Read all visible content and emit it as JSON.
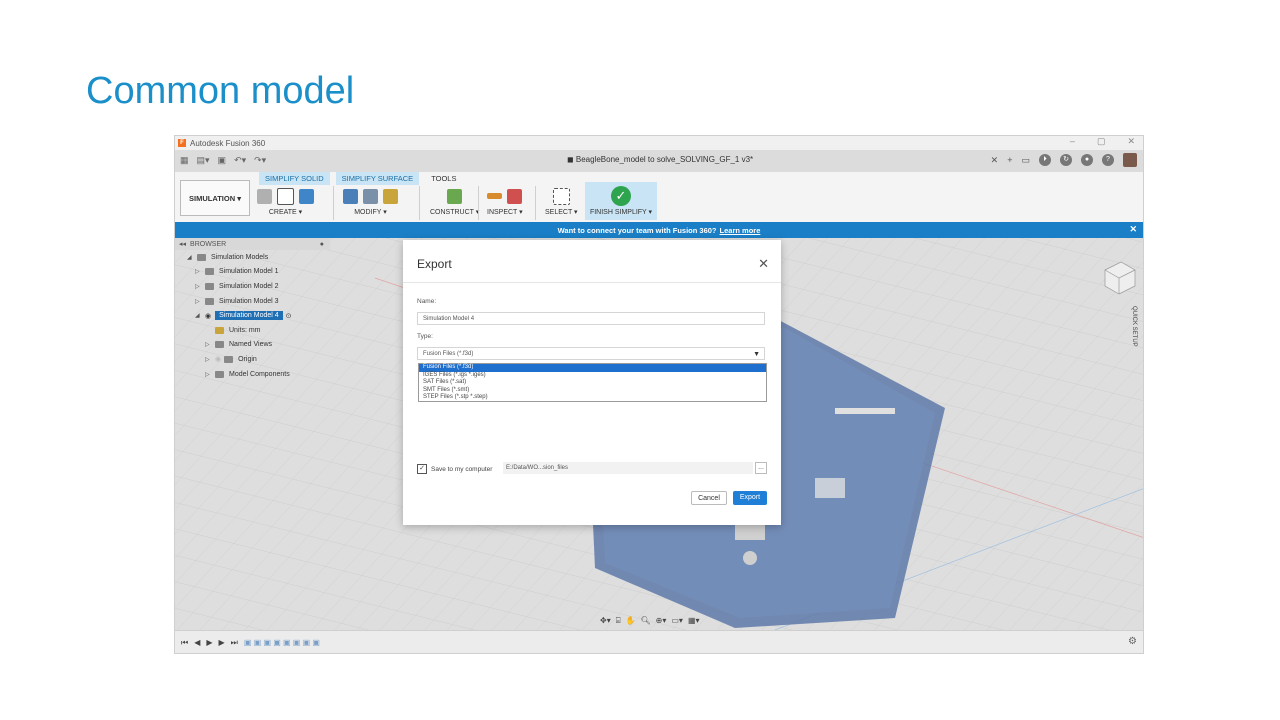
{
  "slide": {
    "title": "Common model"
  },
  "app": {
    "window_title": "Autodesk Fusion 360",
    "document_tab": "BeagleBone_model to solve_SOLVING_GF_1 v3*",
    "workspace": "SIMULATION ▾",
    "tabs": [
      "SIMPLIFY SOLID",
      "SIMPLIFY SURFACE",
      "TOOLS"
    ],
    "groups": {
      "create": "CREATE ▾",
      "modify": "MODIFY ▾",
      "construct": "CONSTRUCT ▾",
      "inspect": "INSPECT ▾",
      "select": "SELECT ▾",
      "finish": "FINISH SIMPLIFY ▾"
    },
    "banner": {
      "text": "Want to connect your team with Fusion 360?",
      "link": "Learn more"
    },
    "browser": {
      "header": "BROWSER",
      "items": {
        "root": "Simulation Models",
        "m1": "Simulation Model 1",
        "m2": "Simulation Model 2",
        "m3": "Simulation Model 3",
        "m4": "Simulation Model 4",
        "units": "Units: mm",
        "named_views": "Named Views",
        "origin": "Origin",
        "model_components": "Model Components"
      }
    },
    "quick_setup": "QUICK SETUP",
    "colors": {
      "accent": "#1a7fc6",
      "finish_check": "#2ea44f",
      "selection": "#1f6fce"
    }
  },
  "dialog": {
    "title": "Export",
    "name_label": "Name:",
    "name_value": "Simulation Model 4",
    "type_label": "Type:",
    "type_value": "Fusion Files (*.f3d)",
    "type_options": [
      "Fusion Files (*.f3d)",
      "IGES Files (*.igs *.iges)",
      "SAT Files (*.sat)",
      "SMT Files (*.smt)",
      "STEP Files (*.stp *.step)"
    ],
    "save_label": "Save to my computer",
    "save_checked": true,
    "path": "E:/Data/WO...sion_files",
    "browse": "...",
    "cancel": "Cancel",
    "export": "Export"
  }
}
